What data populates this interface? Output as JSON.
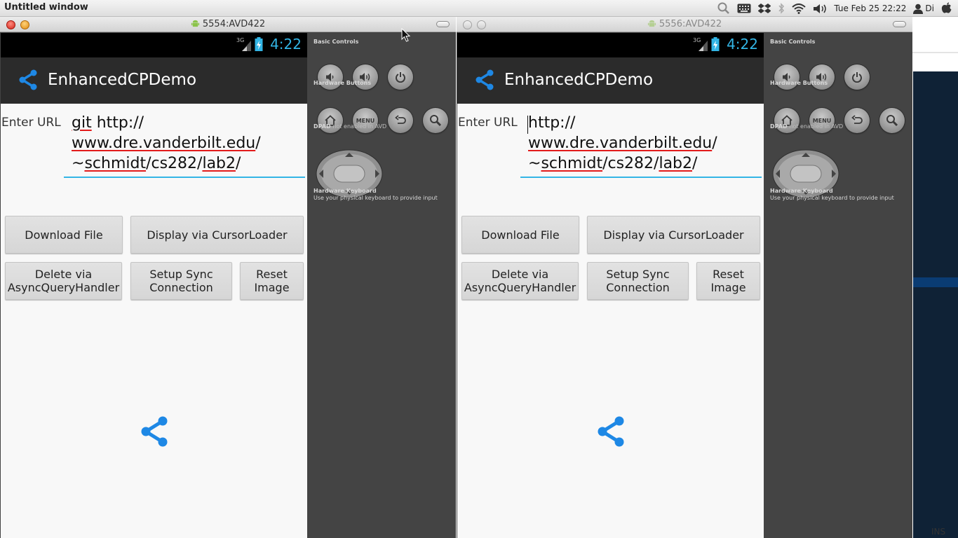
{
  "desktop": {
    "window_title": "Untitled window",
    "clock": "Tue Feb 25 22:22",
    "user": "Di",
    "status_right": "INS"
  },
  "emulators": [
    {
      "window_title": "5554:AVD422",
      "status_clock": "4:22",
      "network": "3G",
      "app_title": "EnhancedCPDemo",
      "url_label": "Enter URL",
      "url_lines": [
        "git http://",
        "www.dre.vanderbilt.edu/",
        "~schmidt/cs282/lab2/"
      ],
      "buttons": {
        "download": "Download File",
        "display": "Display via CursorLoader",
        "delete": "Delete via AsyncQueryHandler",
        "setup_sync": "Setup Sync Connection",
        "reset": "Reset Image"
      }
    },
    {
      "window_title": "5556:AVD422",
      "status_clock": "4:22",
      "network": "3G",
      "app_title": "EnhancedCPDemo",
      "url_label": "Enter URL",
      "url_lines": [
        "http://",
        "www.dre.vanderbilt.edu/",
        "~schmidt/cs282/lab2/"
      ],
      "buttons": {
        "download": "Download File",
        "display": "Display via CursorLoader",
        "delete": "Delete via AsyncQueryHandler",
        "setup_sync": "Setup Sync Connection",
        "reset": "Reset Image"
      }
    }
  ],
  "controls": {
    "basic_controls": "Basic Controls",
    "hardware_buttons": "Hardware Buttons",
    "menu": "MENU",
    "dpad_title": "DPAD",
    "dpad_note": "not enabled in AVD",
    "keyboard_title": "Hardware Keyboard",
    "keyboard_desc": "Use your physical keyboard to provide input"
  },
  "colors": {
    "accent": "#33b5e5",
    "app_icon": "#1e88e5",
    "action_bar": "#2b2b2b",
    "panel": "#444444"
  }
}
